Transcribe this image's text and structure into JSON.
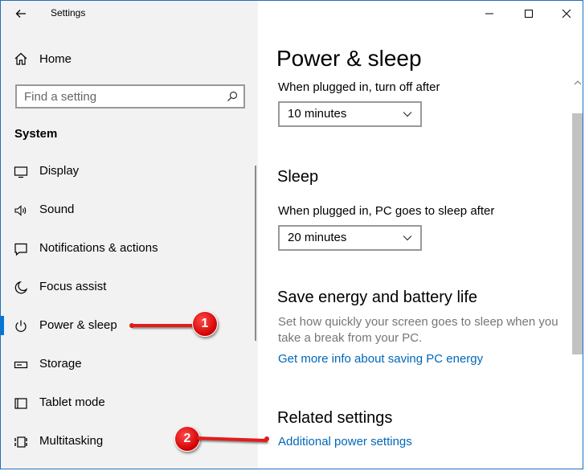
{
  "window": {
    "app_title": "Settings",
    "controls": {
      "minimize": "minimize-icon",
      "maximize": "maximize-icon",
      "close": "close-icon"
    }
  },
  "sidebar": {
    "home_label": "Home",
    "search_placeholder": "Find a setting",
    "section_title": "System",
    "items": [
      {
        "label": "Display",
        "icon": "display-icon"
      },
      {
        "label": "Sound",
        "icon": "sound-icon"
      },
      {
        "label": "Notifications & actions",
        "icon": "notifications-icon"
      },
      {
        "label": "Focus assist",
        "icon": "focus-assist-icon"
      },
      {
        "label": "Power & sleep",
        "icon": "power-icon",
        "active": true
      },
      {
        "label": "Storage",
        "icon": "storage-icon"
      },
      {
        "label": "Tablet mode",
        "icon": "tablet-mode-icon"
      },
      {
        "label": "Multitasking",
        "icon": "multitasking-icon"
      }
    ]
  },
  "main": {
    "page_title": "Power & sleep",
    "screen_label": "When plugged in, turn off after",
    "screen_value": "10 minutes",
    "sleep_heading": "Sleep",
    "sleep_label": "When plugged in, PC goes to sleep after",
    "sleep_value": "20 minutes",
    "energy_heading": "Save energy and battery life",
    "energy_desc": "Set how quickly your screen goes to sleep when you take a break from your PC.",
    "energy_link": "Get more info about saving PC energy",
    "related_heading": "Related settings",
    "related_link": "Additional power settings"
  },
  "annotations": {
    "badge1": "1",
    "badge2": "2",
    "color": "#e41b1b"
  },
  "colors": {
    "accent": "#0078d7",
    "link": "#0067b8",
    "sidebar_bg": "#f2f2f2"
  }
}
